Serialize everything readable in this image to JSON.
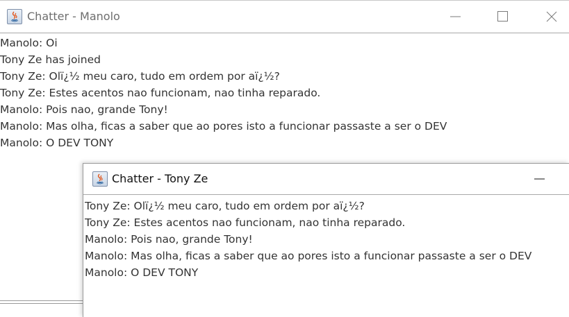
{
  "windows": {
    "manolo": {
      "title": "Chatter - Manolo",
      "icon": "java-cup-icon",
      "controls": [
        "minimize-icon",
        "maximize-icon",
        "close-icon"
      ],
      "messages": [
        "Manolo: Oi",
        "Tony Ze has joined",
        "Tony Ze: Olï¿½ meu caro, tudo em ordem por aï¿½?",
        "Tony Ze: Estes acentos nao funcionam, nao tinha reparado.",
        "Manolo: Pois nao, grande Tony!",
        "Manolo: Mas olha, ficas a saber que ao pores isto a funcionar passaste a ser o DEV",
        "Manolo: O DEV TONY"
      ]
    },
    "tony": {
      "title": "Chatter - Tony Ze",
      "icon": "java-cup-icon",
      "controls": [
        "minimize-icon"
      ],
      "messages": [
        "Tony Ze: Olï¿½ meu caro, tudo em ordem por aï¿½?",
        "Tony Ze: Estes acentos nao funcionam, nao tinha reparado.",
        "Manolo: Pois nao, grande Tony!",
        "Manolo: Mas olha, ficas a saber que ao pores isto a funcionar passaste a ser o DEV",
        "Manolo: O DEV TONY"
      ]
    }
  }
}
